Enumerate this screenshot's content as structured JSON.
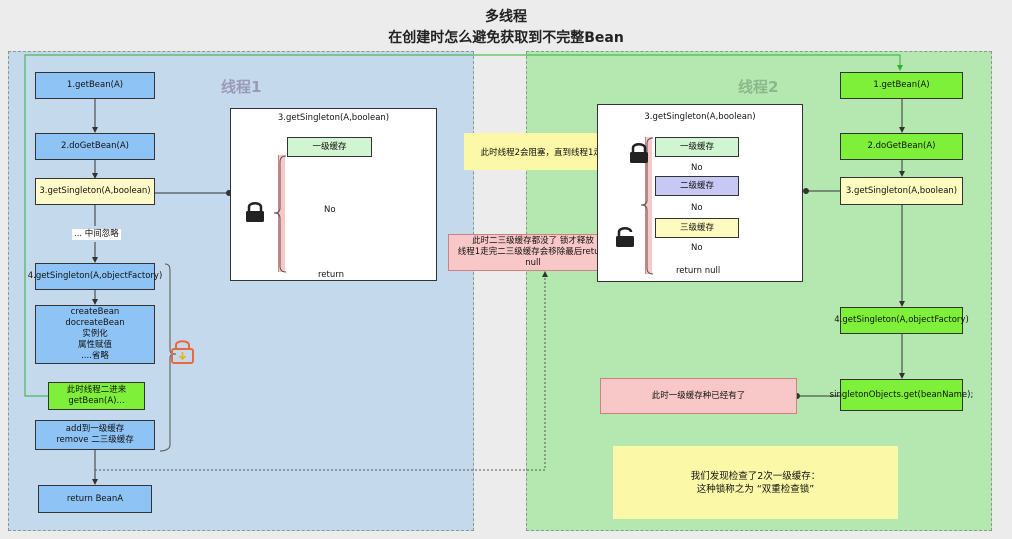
{
  "title": "多线程",
  "subtitle": "在创建时怎么避免获取到不完整Bean",
  "lane1": {
    "label": "线程1",
    "steps": [
      "1.getBean(A)",
      "2.doGetBean(A)",
      "3.getSingleton(A,boolean)",
      "... 中间忽略",
      "4.getSingleton(A,objectFactory)",
      "createBean\ndocreateBean\n实例化\n属性赋值\n....省略",
      "此时线程二进来\ngetBean(A)...",
      "add到一级缓存\nremove 二三级缓存",
      "return BeanA"
    ],
    "panel": {
      "title": "3.getSingleton(A,boolean)",
      "cache1": "一级缓存",
      "no": "No",
      "ret": "return"
    }
  },
  "lane2": {
    "label": "线程2",
    "steps": [
      "1.getBean(A)",
      "2.doGetBean(A)",
      "3.getSingleton(A,boolean)",
      "4.getSingleton(A,objectFactory)",
      "singletonObjects.get(beanName);"
    ],
    "panel": {
      "title": "3.getSingleton(A,boolean)",
      "cache1": "一级缓存",
      "cache2": "二级缓存",
      "cache3": "三级缓存",
      "no1": "No",
      "no2": "No",
      "no3": "No",
      "ret": "return null"
    },
    "found_note": "此时一级缓存种已经有了"
  },
  "notes": {
    "blocked": "此时线程2会阻塞，直到线程1走完",
    "release": "此时二三级缓存都没了 锁才释放\n线程1走完二三级缓存会移除最后return null",
    "conclusion": "我们发现检查了2次一级缓存：\n这种锁称之为 “双重检查锁”"
  },
  "colors": {
    "lane1_bg": "#c5d9ec",
    "lane2_bg": "#b5e8b1",
    "blue_box": "#8ec3f5",
    "green_box": "#7ff03a",
    "note_yellow": "#fbf8a8",
    "pink_note": "#f8c8c8",
    "lock_red": "#e86a3c"
  }
}
